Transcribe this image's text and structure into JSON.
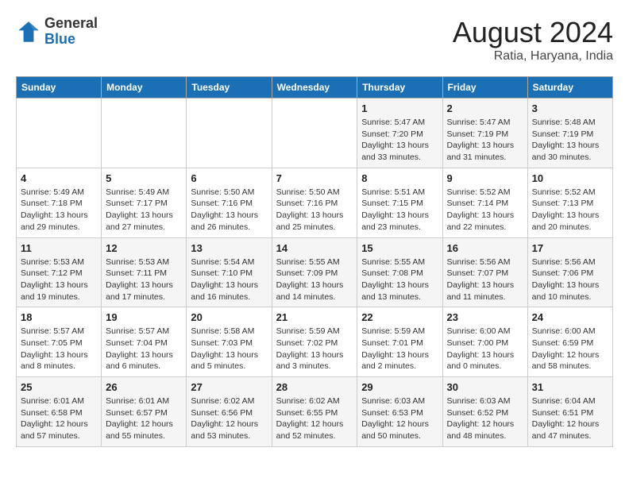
{
  "logo": {
    "general": "General",
    "blue": "Blue"
  },
  "header": {
    "month": "August 2024",
    "location": "Ratia, Haryana, India"
  },
  "weekdays": [
    "Sunday",
    "Monday",
    "Tuesday",
    "Wednesday",
    "Thursday",
    "Friday",
    "Saturday"
  ],
  "weeks": [
    [
      {
        "day": "",
        "info": ""
      },
      {
        "day": "",
        "info": ""
      },
      {
        "day": "",
        "info": ""
      },
      {
        "day": "",
        "info": ""
      },
      {
        "day": "1",
        "info": "Sunrise: 5:47 AM\nSunset: 7:20 PM\nDaylight: 13 hours\nand 33 minutes."
      },
      {
        "day": "2",
        "info": "Sunrise: 5:47 AM\nSunset: 7:19 PM\nDaylight: 13 hours\nand 31 minutes."
      },
      {
        "day": "3",
        "info": "Sunrise: 5:48 AM\nSunset: 7:19 PM\nDaylight: 13 hours\nand 30 minutes."
      }
    ],
    [
      {
        "day": "4",
        "info": "Sunrise: 5:49 AM\nSunset: 7:18 PM\nDaylight: 13 hours\nand 29 minutes."
      },
      {
        "day": "5",
        "info": "Sunrise: 5:49 AM\nSunset: 7:17 PM\nDaylight: 13 hours\nand 27 minutes."
      },
      {
        "day": "6",
        "info": "Sunrise: 5:50 AM\nSunset: 7:16 PM\nDaylight: 13 hours\nand 26 minutes."
      },
      {
        "day": "7",
        "info": "Sunrise: 5:50 AM\nSunset: 7:16 PM\nDaylight: 13 hours\nand 25 minutes."
      },
      {
        "day": "8",
        "info": "Sunrise: 5:51 AM\nSunset: 7:15 PM\nDaylight: 13 hours\nand 23 minutes."
      },
      {
        "day": "9",
        "info": "Sunrise: 5:52 AM\nSunset: 7:14 PM\nDaylight: 13 hours\nand 22 minutes."
      },
      {
        "day": "10",
        "info": "Sunrise: 5:52 AM\nSunset: 7:13 PM\nDaylight: 13 hours\nand 20 minutes."
      }
    ],
    [
      {
        "day": "11",
        "info": "Sunrise: 5:53 AM\nSunset: 7:12 PM\nDaylight: 13 hours\nand 19 minutes."
      },
      {
        "day": "12",
        "info": "Sunrise: 5:53 AM\nSunset: 7:11 PM\nDaylight: 13 hours\nand 17 minutes."
      },
      {
        "day": "13",
        "info": "Sunrise: 5:54 AM\nSunset: 7:10 PM\nDaylight: 13 hours\nand 16 minutes."
      },
      {
        "day": "14",
        "info": "Sunrise: 5:55 AM\nSunset: 7:09 PM\nDaylight: 13 hours\nand 14 minutes."
      },
      {
        "day": "15",
        "info": "Sunrise: 5:55 AM\nSunset: 7:08 PM\nDaylight: 13 hours\nand 13 minutes."
      },
      {
        "day": "16",
        "info": "Sunrise: 5:56 AM\nSunset: 7:07 PM\nDaylight: 13 hours\nand 11 minutes."
      },
      {
        "day": "17",
        "info": "Sunrise: 5:56 AM\nSunset: 7:06 PM\nDaylight: 13 hours\nand 10 minutes."
      }
    ],
    [
      {
        "day": "18",
        "info": "Sunrise: 5:57 AM\nSunset: 7:05 PM\nDaylight: 13 hours\nand 8 minutes."
      },
      {
        "day": "19",
        "info": "Sunrise: 5:57 AM\nSunset: 7:04 PM\nDaylight: 13 hours\nand 6 minutes."
      },
      {
        "day": "20",
        "info": "Sunrise: 5:58 AM\nSunset: 7:03 PM\nDaylight: 13 hours\nand 5 minutes."
      },
      {
        "day": "21",
        "info": "Sunrise: 5:59 AM\nSunset: 7:02 PM\nDaylight: 13 hours\nand 3 minutes."
      },
      {
        "day": "22",
        "info": "Sunrise: 5:59 AM\nSunset: 7:01 PM\nDaylight: 13 hours\nand 2 minutes."
      },
      {
        "day": "23",
        "info": "Sunrise: 6:00 AM\nSunset: 7:00 PM\nDaylight: 13 hours\nand 0 minutes."
      },
      {
        "day": "24",
        "info": "Sunrise: 6:00 AM\nSunset: 6:59 PM\nDaylight: 12 hours\nand 58 minutes."
      }
    ],
    [
      {
        "day": "25",
        "info": "Sunrise: 6:01 AM\nSunset: 6:58 PM\nDaylight: 12 hours\nand 57 minutes."
      },
      {
        "day": "26",
        "info": "Sunrise: 6:01 AM\nSunset: 6:57 PM\nDaylight: 12 hours\nand 55 minutes."
      },
      {
        "day": "27",
        "info": "Sunrise: 6:02 AM\nSunset: 6:56 PM\nDaylight: 12 hours\nand 53 minutes."
      },
      {
        "day": "28",
        "info": "Sunrise: 6:02 AM\nSunset: 6:55 PM\nDaylight: 12 hours\nand 52 minutes."
      },
      {
        "day": "29",
        "info": "Sunrise: 6:03 AM\nSunset: 6:53 PM\nDaylight: 12 hours\nand 50 minutes."
      },
      {
        "day": "30",
        "info": "Sunrise: 6:03 AM\nSunset: 6:52 PM\nDaylight: 12 hours\nand 48 minutes."
      },
      {
        "day": "31",
        "info": "Sunrise: 6:04 AM\nSunset: 6:51 PM\nDaylight: 12 hours\nand 47 minutes."
      }
    ]
  ]
}
